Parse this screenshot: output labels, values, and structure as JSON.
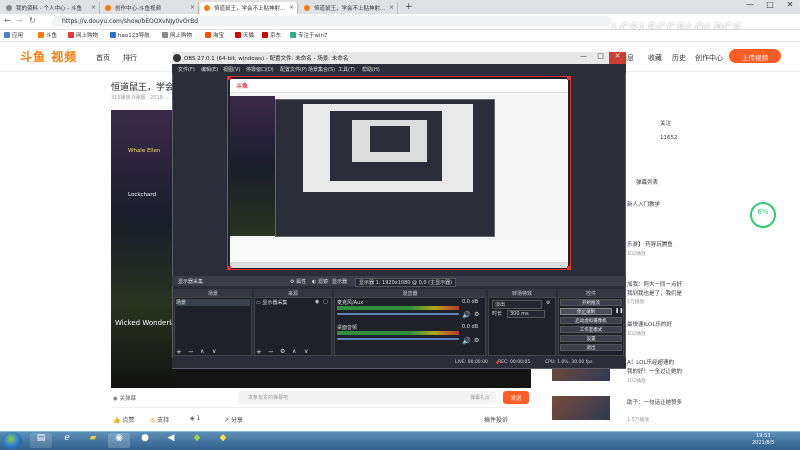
{
  "browser": {
    "tabs": [
      {
        "label": "我的资料 - 个人中心 - 斗鱼",
        "active": false
      },
      {
        "label": "创作中心-斗鱼视频",
        "active": false
      },
      {
        "label": "恒道鼠王，学会不上贴神射...",
        "active": true
      },
      {
        "label": "恒道鼠王，学会不上贴神射...",
        "active": false
      }
    ],
    "new_tab": "+",
    "url": "https://v.douyu.com/show/bEOOXvNJy0vOrBd",
    "watermark": "LCSLECCBLOLPCS",
    "window_controls": [
      "—",
      "□",
      "✕"
    ],
    "bookmarks": [
      "应用",
      "斗鱼",
      "网上购物",
      "hao123导航",
      "网上购物",
      "淘宝",
      "天猫",
      "京东",
      "专注于win7"
    ]
  },
  "site": {
    "logo_main": "斗鱼",
    "logo_sub": "视频",
    "nav": [
      "首页",
      "排行"
    ],
    "right_nav": [
      "消息",
      "收藏",
      "历史",
      "创作中心"
    ],
    "upload_label": "上传视频",
    "video_title": "恒道鼠王，学会不...",
    "video_meta": "315播放·0弹幕 · 2018-..."
  },
  "player": {
    "overlay_names": [
      "Whale Ellen",
      "Lockchard"
    ],
    "overlay_text": "Wicked Wonderla",
    "danmu_placeholder": "发条有爱的弹幕吧",
    "danmu_rules": "弹幕礼仪",
    "send_label": "发送",
    "actions": [
      "点赞",
      "鱼丸",
      "支持",
      "1",
      "分享"
    ],
    "share_count": "",
    "report": "稿件投诉"
  },
  "right_panel": {
    "items": [
      {
        "title": "关注",
        "sub": ""
      },
      {
        "title": "11652",
        "sub": ""
      },
      {
        "title": "弹幕列表",
        "sub": ""
      },
      {
        "title": "新人入门教学",
        "sub": ""
      },
      {
        "title": "乐游】 药导玩腾鱼",
        "sub": "102播放"
      },
      {
        "title": "加我：阿大一同一点好",
        "sub": "1万播放"
      },
      {
        "title": "我到我也是了，我们是",
        "sub": ""
      },
      {
        "title": "最快速ILOL乐的好",
        "sub": "102播放"
      },
      {
        "title": "A！LOL乐经超速的",
        "sub": "102播放"
      },
      {
        "title": "我的好！一全过让她的",
        "sub": "102播放"
      },
      {
        "title": "助子：一句话让她赞多",
        "sub": "1.5万播放"
      }
    ],
    "progress_ring": "6%",
    "progress_ring_value": 0.06
  },
  "obs": {
    "title": "OBS 27.0.1 (64-bit, windows) - 配置文件: 未命名 - 场景: 未命名",
    "menu": [
      "文件(F)",
      "编辑(E)",
      "视图(V)",
      "停靠窗口(D)",
      "配置文件(P)",
      "场景集合(S)",
      "工具(T)",
      "帮助(H)"
    ],
    "scene_bar": [
      "显示器采集",
      "属性",
      "滤镜",
      "显示器",
      "显示器 1: 1920x1080 @ 0,0 (主显示器)"
    ],
    "docks": {
      "scenes": {
        "header": "场景",
        "items": [
          "场景"
        ]
      },
      "sources": {
        "header": "来源",
        "items": [
          "显示器采集"
        ]
      },
      "mixer": {
        "header": "混音器",
        "channels": [
          {
            "name": "麦克风/Aux",
            "db": "0.0 dB"
          },
          {
            "name": "桌面音频",
            "db": "0.0 dB"
          }
        ]
      },
      "transitions": {
        "header": "转场特效",
        "type": "淡出",
        "duration_label": "时长",
        "duration": "300 ms"
      },
      "controls": {
        "header": "控件",
        "buttons": [
          "开始推流",
          "停止录制",
          "启动虚拟摄像机",
          "工作室模式",
          "设置",
          "退出"
        ]
      }
    },
    "status": [
      "LIVE: 00:00:00",
      "REC: 00:00:05",
      "CPU: 1.0%, 30.00 fps"
    ]
  },
  "taskbar": {
    "apps": [
      "explorer",
      "ie",
      "folder",
      "chrome",
      "obs",
      "media",
      "chat",
      "game"
    ],
    "clock_time": "19:53",
    "clock_date": "2021/8/5"
  }
}
